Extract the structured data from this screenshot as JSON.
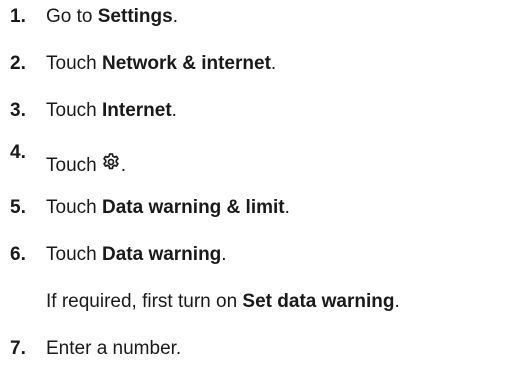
{
  "steps": [
    {
      "number": "1.",
      "before": "Go to ",
      "bold": "Settings",
      "after": "."
    },
    {
      "number": "2.",
      "before": "Touch ",
      "bold": "Network & internet",
      "after": "."
    },
    {
      "number": "3.",
      "before": "Touch ",
      "bold": "Internet",
      "after": "."
    },
    {
      "number": "4.",
      "before": "Touch",
      "icon": "settings-gear-icon",
      "after": "."
    },
    {
      "number": "5.",
      "before": "Touch ",
      "bold": "Data warning & limit",
      "after": "."
    },
    {
      "number": "6.",
      "before": "Touch ",
      "bold": "Data warning",
      "after": "."
    },
    {
      "number": "7.",
      "before": "Enter a number.",
      "after": ""
    }
  ],
  "note": {
    "before": "If required, first turn on ",
    "bold": "Set data warning",
    "after": "."
  }
}
